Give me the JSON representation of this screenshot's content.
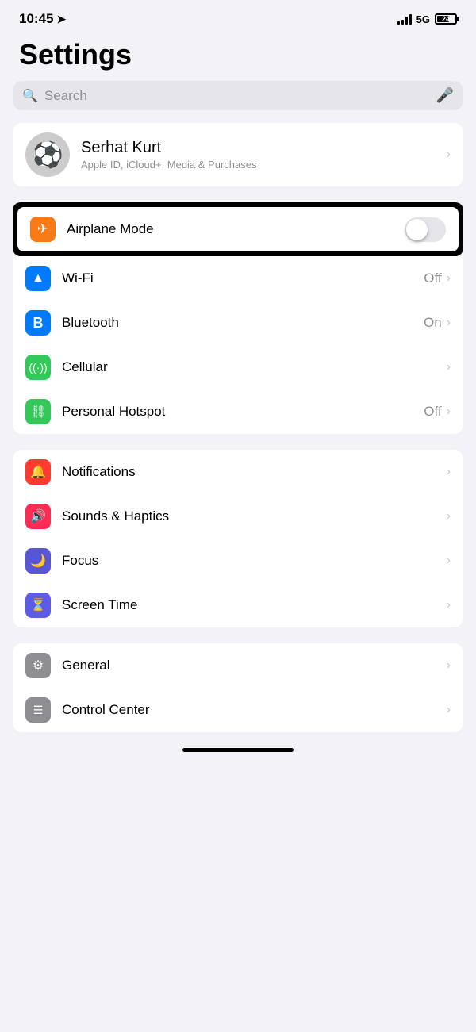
{
  "statusBar": {
    "time": "10:45",
    "networkType": "5G",
    "batteryPercent": "24"
  },
  "header": {
    "title": "Settings"
  },
  "search": {
    "placeholder": "Search"
  },
  "profile": {
    "name": "Serhat Kurt",
    "subtitle": "Apple ID, iCloud+, Media & Purchases",
    "avatar": "⚽"
  },
  "connectivity": {
    "airplaneMode": {
      "label": "Airplane Mode",
      "enabled": false,
      "icon": "✈"
    },
    "wifi": {
      "label": "Wi-Fi",
      "value": "Off",
      "icon": "📶"
    },
    "bluetooth": {
      "label": "Bluetooth",
      "value": "On",
      "icon": "Ƀ"
    },
    "cellular": {
      "label": "Cellular",
      "value": "",
      "icon": "((·))"
    },
    "personalHotspot": {
      "label": "Personal Hotspot",
      "value": "Off",
      "icon": "8"
    }
  },
  "notifications": {
    "items": [
      {
        "label": "Notifications",
        "value": "",
        "icon": "🔔",
        "bg": "red"
      },
      {
        "label": "Sounds & Haptics",
        "value": "",
        "icon": "🔊",
        "bg": "pink"
      },
      {
        "label": "Focus",
        "value": "",
        "icon": "🌙",
        "bg": "indigo"
      },
      {
        "label": "Screen Time",
        "value": "",
        "icon": "⏳",
        "bg": "indigo"
      }
    ]
  },
  "general": {
    "items": [
      {
        "label": "General",
        "value": "",
        "icon": "⚙",
        "bg": "gray"
      },
      {
        "label": "Control Center",
        "value": "",
        "icon": "☰",
        "bg": "gray"
      }
    ]
  },
  "labels": {
    "on": "On",
    "off": "Off"
  }
}
